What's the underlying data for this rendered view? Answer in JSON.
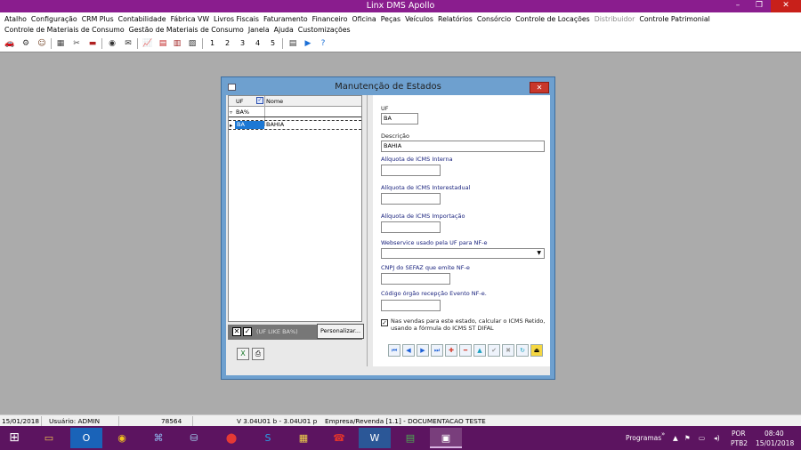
{
  "window": {
    "title": "Linx DMS Apollo",
    "min": "–",
    "max": "❐",
    "close": "✕"
  },
  "menu_row1": [
    {
      "label": "Atalho",
      "dim": false
    },
    {
      "label": "Configuração",
      "dim": false
    },
    {
      "label": "CRM Plus",
      "dim": false
    },
    {
      "label": "Contabilidade",
      "dim": false
    },
    {
      "label": "Fábrica VW",
      "dim": false
    },
    {
      "label": "Livros Fiscais",
      "dim": false
    },
    {
      "label": "Faturamento",
      "dim": false
    },
    {
      "label": "Financeiro",
      "dim": false
    },
    {
      "label": "Oficina",
      "dim": false
    },
    {
      "label": "Peças",
      "dim": false
    },
    {
      "label": "Veículos",
      "dim": false
    },
    {
      "label": "Relatórios",
      "dim": false
    },
    {
      "label": "Consórcio",
      "dim": false
    },
    {
      "label": "Controle de Locações",
      "dim": false
    },
    {
      "label": "Distribuidor",
      "dim": true
    },
    {
      "label": "Controle Patrimonial",
      "dim": false
    }
  ],
  "menu_row2": [
    {
      "label": "Controle de Materiais de Consumo",
      "dim": false
    },
    {
      "label": "Gestão de Materiais de Consumo",
      "dim": false
    },
    {
      "label": "Janela",
      "dim": false
    },
    {
      "label": "Ajuda",
      "dim": false
    },
    {
      "label": "Customizações",
      "dim": false
    }
  ],
  "toolbar": {
    "numbers": [
      "1",
      "2",
      "3",
      "4",
      "5"
    ]
  },
  "dialog": {
    "title": "Manutenção de Estados",
    "close": "✕",
    "grid": {
      "col_uf": "UF",
      "col_nome": "Nome",
      "filter_indicator": "▿",
      "filter_value": "BA%",
      "rows": [
        {
          "uf": "BA",
          "nome": "BAHIA"
        }
      ],
      "row_indicator": "▸"
    },
    "filter_bar": {
      "text": "(UF LIKE BA%)",
      "x": "✕",
      "check": "✓"
    },
    "personalize_label": "Personalizar...",
    "form": {
      "uf_label": "UF",
      "uf_value": "BA",
      "descricao_label": "Descrição",
      "descricao_value": "BAHIA",
      "icms_interna_label": "Alíquota de ICMS Interna",
      "icms_interna_value": "",
      "icms_interestadual_label": "Alíquota de ICMS Interestadual",
      "icms_interestadual_value": "",
      "icms_importacao_label": "Alíquota de ICMS Importação",
      "icms_importacao_value": "",
      "webservice_label": "Webservice usado pela UF para NF-e",
      "webservice_value": "",
      "cnpj_label": "CNPJ do SEFAZ que emite NF-e",
      "cnpj_value": "",
      "codigo_label": "Código órgão recepção Evento NF-e.",
      "codigo_value": "",
      "checkbox_text": "Nas vendas para este estado, calcular o ICMS Retido, usando a fórmula do ICMS ST DIFAL",
      "checkbox_checked": true
    }
  },
  "statusbar": {
    "date": "15/01/2018",
    "user": "Usuário: ADMIN",
    "code": "78564",
    "version": "V 3.04U01 b  -  3.04U01 p",
    "company": "Empresa/Revenda [1.1] - DOCUMENTACAO TESTE"
  },
  "taskbar": {
    "programs": "Programas",
    "lang": "POR",
    "layout": "PTB2",
    "time": "08:40",
    "date": "15/01/2018"
  }
}
